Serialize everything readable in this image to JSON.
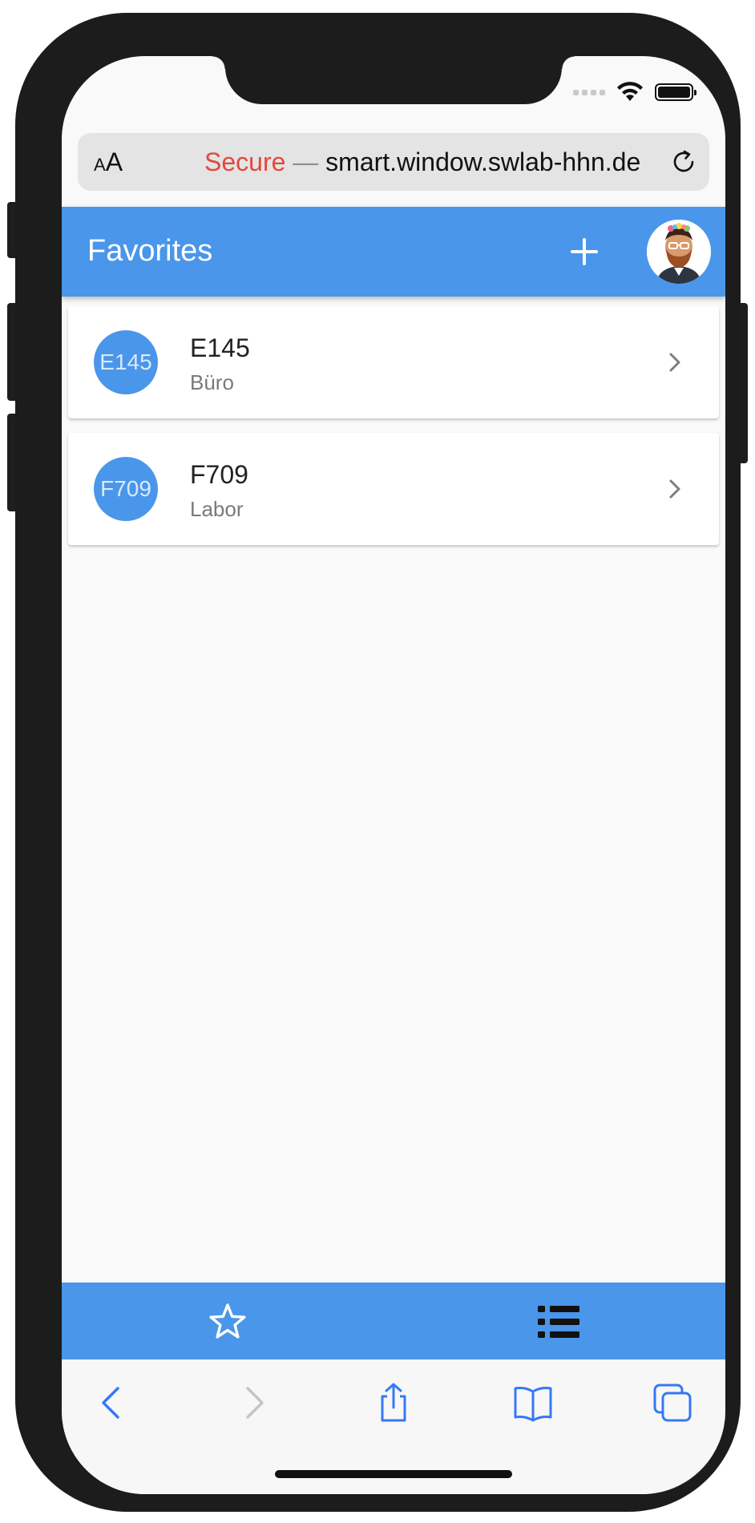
{
  "browser": {
    "text_size_small": "A",
    "text_size_large": "A",
    "url_secure_label": "Secure",
    "url_separator": "—",
    "url": "smart.window.swlab-hhn.de"
  },
  "header": {
    "title": "Favorites",
    "add_icon": "plus-icon",
    "avatar_icon": "user-avatar"
  },
  "favorites": [
    {
      "badge": "E145",
      "title": "E145",
      "subtitle": "Büro"
    },
    {
      "badge": "F709",
      "title": "F709",
      "subtitle": "Labor"
    }
  ],
  "bottom_nav": {
    "items": [
      "star-icon",
      "list-icon"
    ]
  },
  "safari_toolbar": {
    "items": [
      "back-icon",
      "forward-icon",
      "share-icon",
      "bookmarks-icon",
      "tabs-icon"
    ]
  },
  "colors": {
    "primary": "#4a96ea",
    "secure_red": "#e4473d",
    "toolbar_blue": "#3478f6",
    "disabled_gray": "#c4c4c8"
  }
}
